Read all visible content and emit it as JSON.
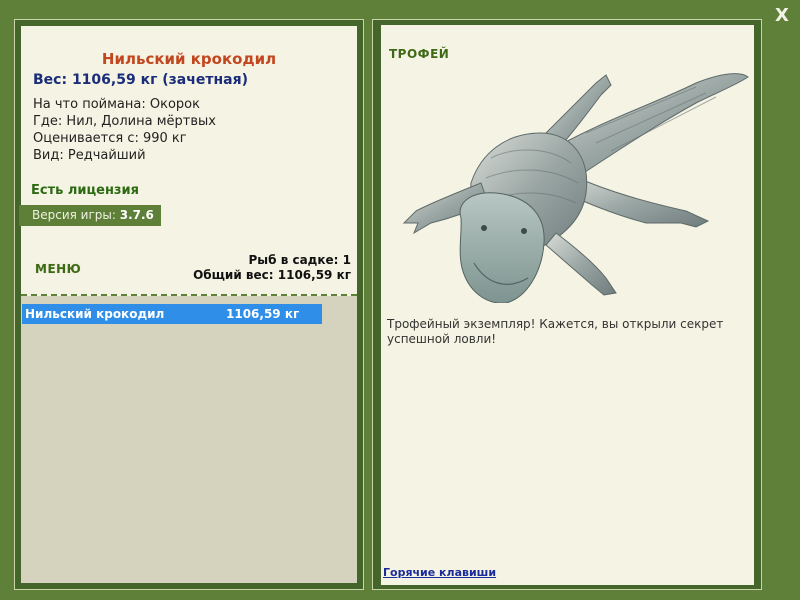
{
  "close_label": "X",
  "fish": {
    "name": "Нильский крокодил",
    "weight_line": "Вес: 1106,59 кг (зачетная)",
    "bait_line": "На что поймана: Окорок",
    "place_line": "Где: Нил, Долина мёртвых",
    "value_line": "Оценивается с: 990 кг",
    "kind_line": "Вид: Редчайший"
  },
  "license_label": "Есть лицензия",
  "version": {
    "label": "Версия игры: ",
    "value": "3.7.6"
  },
  "menu_label": "МЕНЮ",
  "keepnet": {
    "count_line": "Рыб в садке: 1",
    "total_line": "Общий вес: 1106,59 кг"
  },
  "catch_list": [
    {
      "name": "Нильский крокодил",
      "weight": "1106,59 кг"
    }
  ],
  "trophy": {
    "label": "ТРОФЕЙ",
    "image_icon": "crocodile-trophy-image",
    "message": "Трофейный экземпляр! Кажется, вы открыли секрет успешной ловли!"
  },
  "hotkeys_label": "Горячие клавиши",
  "colors": {
    "background": "#5e8038",
    "panel_light": "#f5f3e3",
    "title_orange": "#c2461e",
    "weight_blue": "#1a2c7a",
    "selection_blue": "#2f8fe8",
    "license_green": "#2c6a12"
  }
}
